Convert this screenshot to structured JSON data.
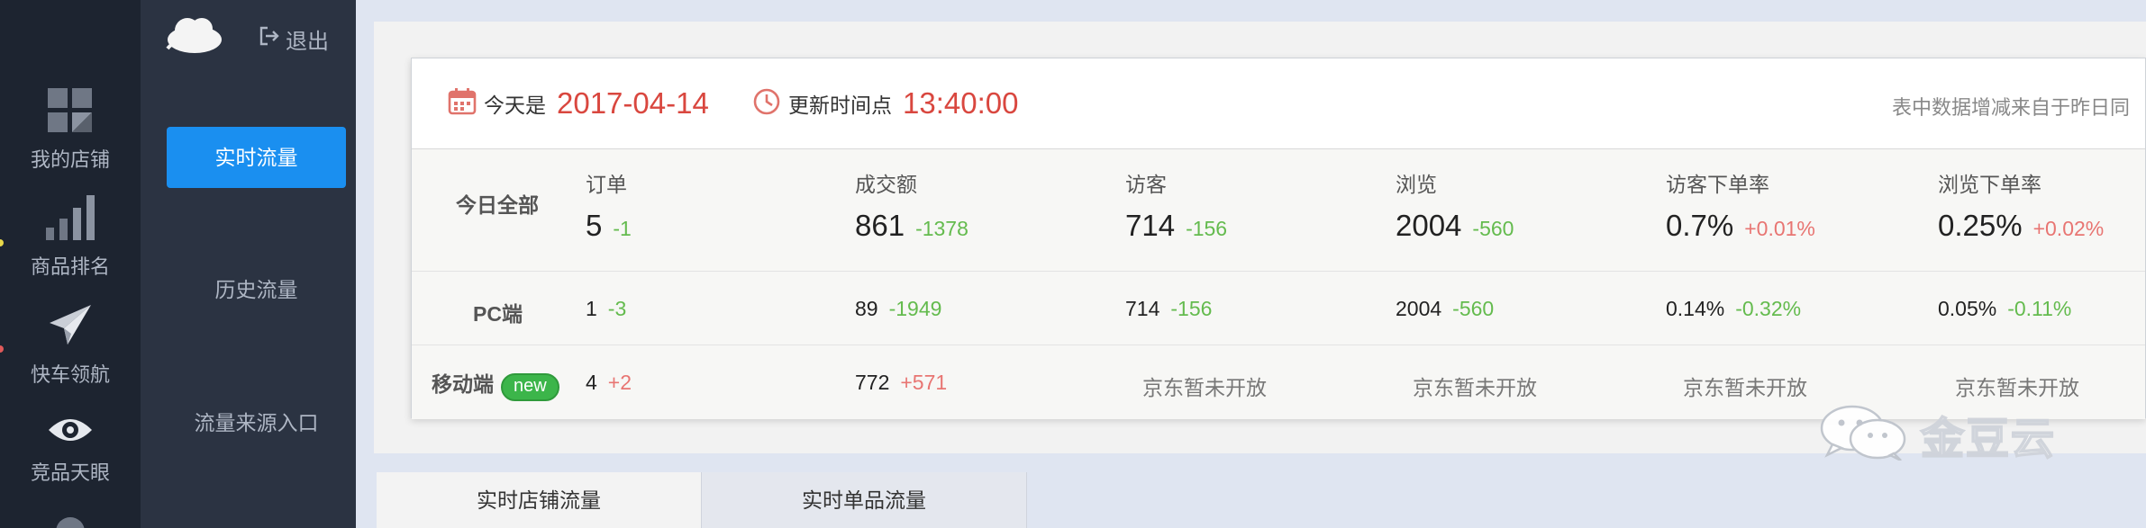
{
  "rail": {
    "items": [
      {
        "label": "我的店铺",
        "icon": "grid-icon"
      },
      {
        "label": "商品排名",
        "icon": "bar-chart-icon"
      },
      {
        "label": "快车领航",
        "icon": "paper-plane-icon"
      },
      {
        "label": "竞品天眼",
        "icon": "eye-icon"
      }
    ]
  },
  "submenu": {
    "logout_label": "退出",
    "items": [
      {
        "label": "实时流量",
        "active": true
      },
      {
        "label": "历史流量",
        "active": false
      },
      {
        "label": "流量来源入口",
        "active": false
      }
    ]
  },
  "header": {
    "today_label": "今天是",
    "today_value": "2017-04-14",
    "update_label": "更新时间点",
    "update_value": "13:40:00",
    "note": "表中数据增减来自于昨日同"
  },
  "table": {
    "columns": [
      "订单",
      "成交额",
      "访客",
      "浏览",
      "访客下单率",
      "浏览下单率"
    ],
    "rows": [
      {
        "title": "今日全部",
        "cells": [
          {
            "value": "5",
            "delta": "-1"
          },
          {
            "value": "861",
            "delta": "-1378"
          },
          {
            "value": "714",
            "delta": "-156"
          },
          {
            "value": "2004",
            "delta": "-560"
          },
          {
            "value": "0.7%",
            "delta": "+0.01%"
          },
          {
            "value": "0.25%",
            "delta": "+0.02%"
          }
        ]
      },
      {
        "title": "PC端",
        "cells": [
          {
            "value": "1",
            "delta": "-3"
          },
          {
            "value": "89",
            "delta": "-1949"
          },
          {
            "value": "714",
            "delta": "-156"
          },
          {
            "value": "2004",
            "delta": "-560"
          },
          {
            "value": "0.14%",
            "delta": "-0.32%"
          },
          {
            "value": "0.05%",
            "delta": "-0.11%"
          }
        ]
      },
      {
        "title": "移动端",
        "badge": "new",
        "cells": [
          {
            "value": "4",
            "delta": "+2"
          },
          {
            "value": "772",
            "delta": "+571"
          },
          {
            "na": "京东暂未开放"
          },
          {
            "na": "京东暂未开放"
          },
          {
            "na": "京东暂未开放"
          },
          {
            "na": "京东暂未开放"
          }
        ]
      }
    ]
  },
  "tabs": [
    {
      "label": "实时店铺流量",
      "active": true
    },
    {
      "label": "实时单品流量",
      "active": false
    }
  ],
  "watermark": "金豆云",
  "colors": {
    "accent": "#1a8ff0",
    "highlight_red": "#d9473f",
    "negative_green": "#64bb4e",
    "positive_red": "#e87572",
    "badge_green": "#3cb54a"
  }
}
